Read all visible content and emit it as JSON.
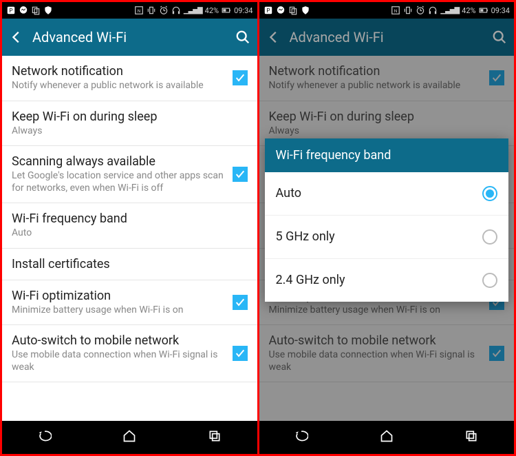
{
  "status": {
    "battery": "42%",
    "time": "09:34"
  },
  "header": {
    "title": "Advanced Wi-Fi"
  },
  "items": [
    {
      "title": "Network notification",
      "sub": "Notify whenever a public network is available",
      "checked": true
    },
    {
      "title": "Keep Wi-Fi on during sleep",
      "sub": "Always"
    },
    {
      "title": "Scanning always available",
      "sub": "Let Google's location service and other apps scan for networks, even when Wi-Fi is off",
      "checked": true
    },
    {
      "title": "Wi-Fi frequency band",
      "sub": "Auto"
    },
    {
      "title": "Install certificates"
    },
    {
      "title": "Wi-Fi optimization",
      "sub": "Minimize battery usage when Wi-Fi is on",
      "checked": true
    },
    {
      "title": "Auto-switch to mobile network",
      "sub": "Use mobile data connection when Wi-Fi signal is weak",
      "checked": true
    }
  ],
  "dialog": {
    "title": "Wi-Fi frequency band",
    "options": [
      "Auto",
      "5 GHz only",
      "2.4 GHz only"
    ],
    "selected": 0
  }
}
